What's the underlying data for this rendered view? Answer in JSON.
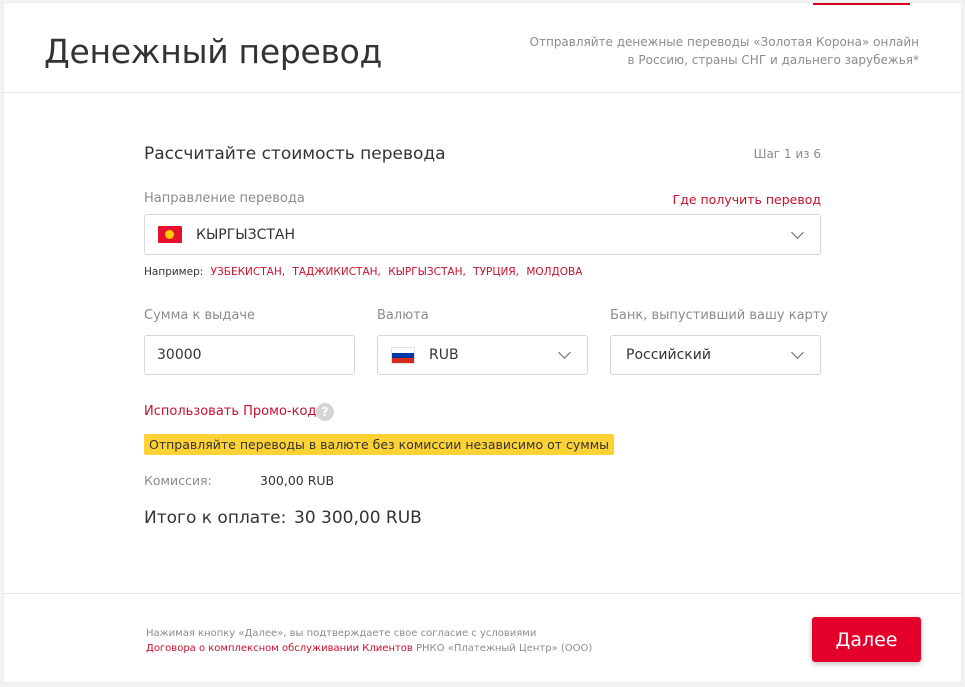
{
  "header": {
    "title": "Денежный перевод",
    "tagline": "Отправляйте денежные переводы «Золотая Корона» онлайн в Россию, страны СНГ и дальнего зарубежья*"
  },
  "form": {
    "section_title": "Рассчитайте стоимость перевода",
    "step": "Шаг 1 из 6",
    "direction_label": "Направление перевода",
    "where_to_receive_link": "Где получить перевод",
    "direction_value": "КЫРГЫЗСТАН",
    "examples_label": "Например:",
    "examples": [
      "УЗБЕКИСТАН,",
      "ТАДЖИКИСТАН,",
      "КЫРГЫЗСТАН,",
      "ТУРЦИЯ,",
      "МОЛДОВА"
    ],
    "amount_label": "Сумма к выдаче",
    "amount_value": "30000",
    "currency_label": "Валюта",
    "currency_value": "RUB",
    "bank_label": "Банк, выпустивший вашу карту",
    "bank_value": "Российский",
    "promo_link": "Использовать Промо-код",
    "help_glyph": "?",
    "banner": "Отправляйте переводы в валюте без комиссии независимо от суммы",
    "fee_label": "Комиссия:",
    "fee_value": "300,00 RUB",
    "total_label": "Итого к оплате:",
    "total_value": "30 300,00 RUB"
  },
  "footer": {
    "consent_text": "Нажимая кнопку «Далее», вы подтверждаете свое согласие с условиями",
    "contract_link": "Договора о комплексном обслуживании Клиентов",
    "consent_suffix": " РНКО «Платежный Центр» (ООО)",
    "next_button": "Далее"
  },
  "colors": {
    "accent": "#e4002b",
    "link": "#c8102e",
    "banner": "#fdd235"
  },
  "icons": [
    "kyrgyzstan-flag-icon",
    "russia-flag-icon",
    "chevron-down-icon",
    "question-mark-icon"
  ]
}
